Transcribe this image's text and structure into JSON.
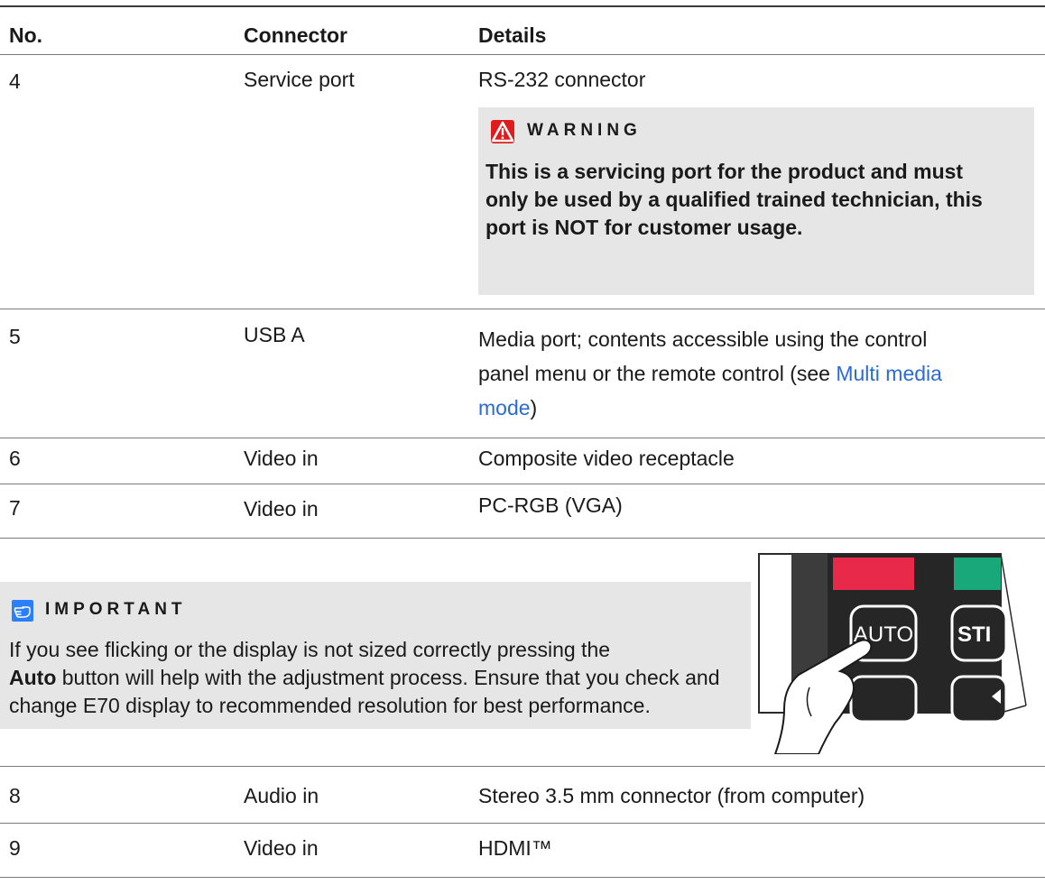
{
  "table": {
    "headers": [
      "No.",
      "Connector",
      "Details"
    ],
    "rows_top": [
      {
        "no": "4",
        "connector": "Service port",
        "details": "RS-232 connector"
      },
      {
        "no": "5",
        "connector": "USB A",
        "details_line1": "Media port; contents accessible using the control",
        "details_line2_pre": "panel menu or the remote control (see ",
        "details_link_a": "Multi media",
        "details_link_b": "mode",
        "details_line3_post": ")"
      },
      {
        "no": "6",
        "connector": "Video in",
        "details": "Composite video receptacle"
      },
      {
        "no": "7",
        "connector": "Video in",
        "details": "PC-RGB (VGA)"
      }
    ],
    "rows_bottom": [
      {
        "no": "8",
        "connector": "Audio in",
        "details": "Stereo 3.5 mm connector (from computer)"
      },
      {
        "no": "9",
        "connector": "Video in",
        "details": "HDMI™"
      }
    ]
  },
  "warning": {
    "title": "WARNING",
    "text": "This is a servicing port for the product and must only be used by a qualified trained technician, this port is NOT for customer usage."
  },
  "important": {
    "title": "IMPORTANT",
    "text_pre": "If you see flicking or the display is not sized correctly pressing the",
    "text_bold": "Auto",
    "text_post": "button will help with the adjustment process. Ensure that you check and change E70 display to recommended resolution for best performance."
  },
  "figure": {
    "button_auto": "AUTO",
    "button_partial": "STI"
  },
  "colors": {
    "warning_icon": "#e01b1b",
    "important_icon": "#2a7fff",
    "link": "#2a6bd8",
    "note_bg": "#e6e6e6"
  }
}
